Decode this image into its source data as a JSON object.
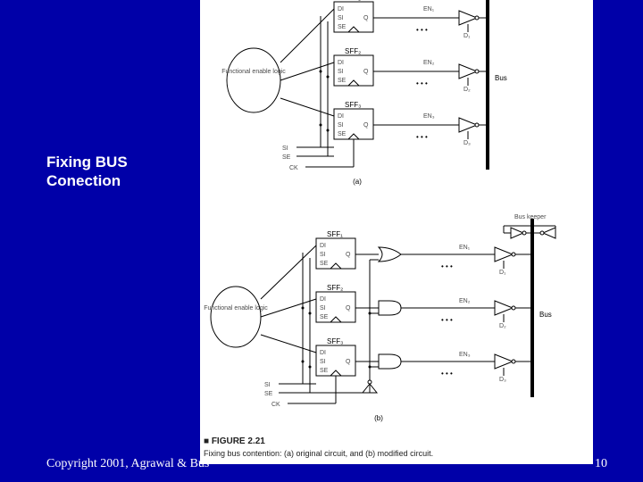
{
  "slide": {
    "title_line1": "Fixing BUS",
    "title_line2": "Conection",
    "footer_left": "Copyright 2001, Agrawal & Bus",
    "page_number": "10"
  },
  "figure": {
    "caption_head": "FIGURE 2.21",
    "caption_text": "Fixing bus contention: (a) original circuit, and (b) modified circuit.",
    "sub_a_label": "(a)",
    "sub_b_label": "(b)",
    "block_title_top": "Functional enable logic",
    "block_title_bottom": "Functional enable logic",
    "bus_label": "Bus",
    "bus_keeper_label": "Bus keeper",
    "ck_label": "CK",
    "si_label": "SI",
    "se_label": "SE",
    "sff_labels": [
      "SFF₁",
      "SFF₂",
      "SFF₃"
    ],
    "pin_DI": "DI",
    "pin_SI": "SI",
    "pin_SE": "SE",
    "pin_Q": "Q",
    "en_labels": [
      "EN₁",
      "EN₂",
      "EN₃"
    ],
    "d_labels": [
      "D₁",
      "D₂",
      "D₃"
    ]
  }
}
